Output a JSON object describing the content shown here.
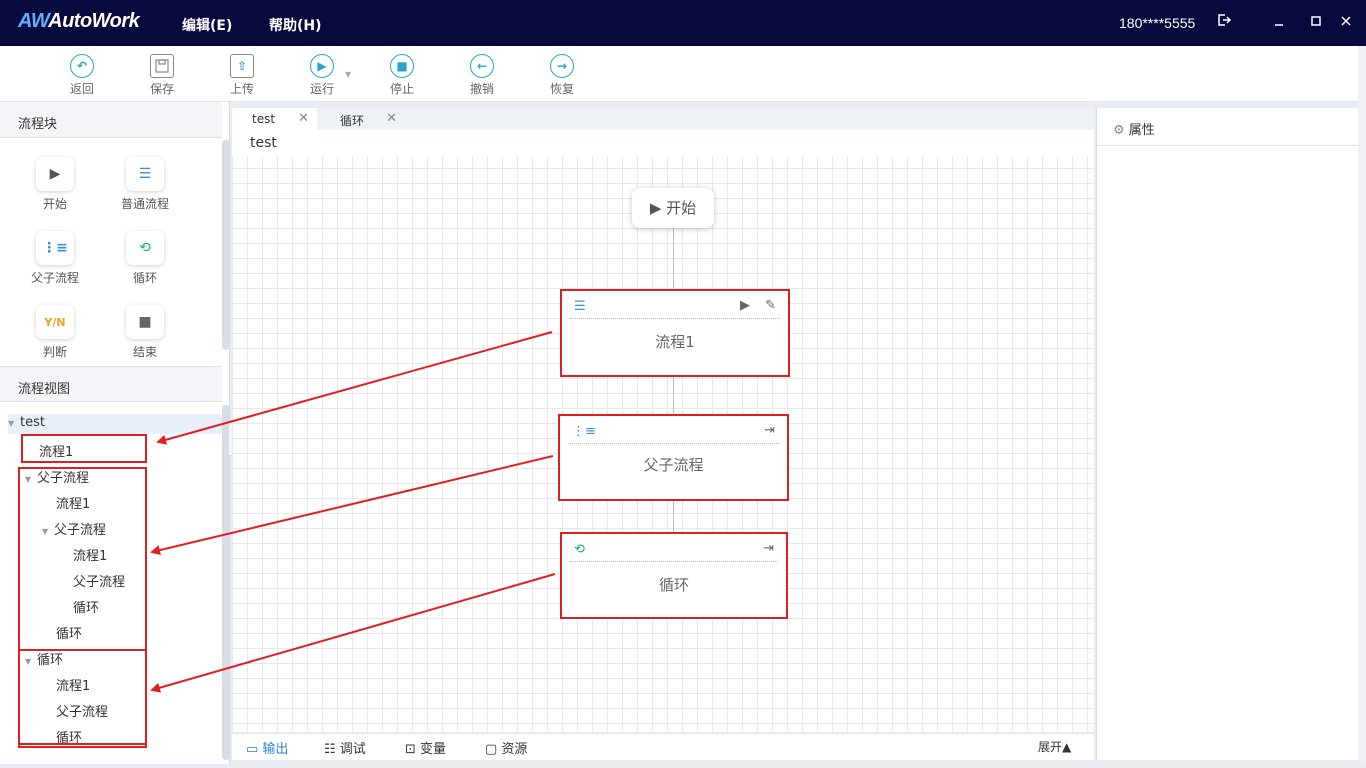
{
  "app": {
    "logo_mark": "AW",
    "logo_text": "AutoWork",
    "user": "180****5555"
  },
  "menu": {
    "edit": "编辑(E)",
    "help": "帮助(H)"
  },
  "window_controls": {
    "logout_icon": "exit-icon",
    "minimize_icon": "minimize-icon",
    "maximize_icon": "maximize-icon",
    "close_icon": "close-icon"
  },
  "toolbar": {
    "back": "返回",
    "save": "保存",
    "upload": "上传",
    "run": "运行",
    "stop": "停止",
    "undo": "撤销",
    "redo": "恢复"
  },
  "left": {
    "blocks_title": "流程块",
    "blocks": [
      "开始",
      "普通流程",
      "父子流程",
      "循环",
      "判断",
      "结束"
    ],
    "yn_icon_text": "Y/N",
    "view_title": "流程视图",
    "tree": {
      "root": "test",
      "n1": "流程1",
      "n2": "父子流程",
      "n2_1": "流程1",
      "n2_2": "父子流程",
      "n2_2_1": "流程1",
      "n2_2_2": "父子流程",
      "n2_2_3": "循环",
      "n2_3": "循环",
      "n3": "循环",
      "n3_1": "流程1",
      "n3_2": "父子流程",
      "n3_3": "循环"
    },
    "collapse_glyph": "«"
  },
  "tabs": [
    {
      "label": "test"
    },
    {
      "label": "循环"
    }
  ],
  "canvas": {
    "title": "test",
    "start_label": "开始",
    "nodes": [
      {
        "label": "流程1"
      },
      {
        "label": "父子流程"
      },
      {
        "label": "循环"
      }
    ]
  },
  "bottom": {
    "output": "输出",
    "debug": "调试",
    "variables": "变量",
    "resources": "资源",
    "expand": "展开▲"
  },
  "right": {
    "title": "属性"
  },
  "colors": {
    "titlebar": "#08093d",
    "accent": "#27a5c8",
    "annotation_red": "#e02020"
  }
}
